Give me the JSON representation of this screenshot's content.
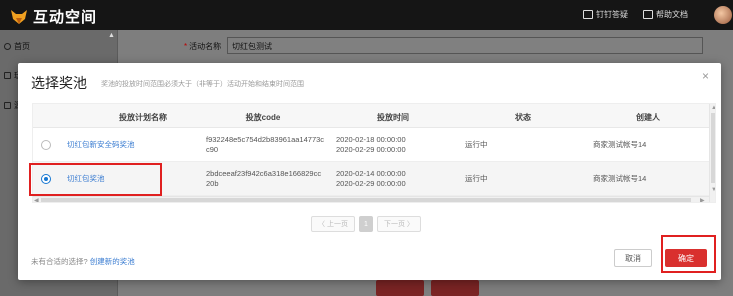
{
  "app": {
    "logo_text": "互动空间"
  },
  "topbar": {
    "pin_answer_label": "钉钉答疑",
    "help_docs_label": "帮助文档"
  },
  "sidebar": {
    "items": [
      {
        "label": "首页"
      },
      {
        "label": "玩"
      },
      {
        "label": "源"
      }
    ]
  },
  "background_form": {
    "field_label": "活动名称",
    "field_value": "切红包测试"
  },
  "modal": {
    "title": "选择奖池",
    "hint": "奖池的投放时间范围必须大于（非等于）活动开始和结束时间范围",
    "close": "×",
    "columns": [
      "投放计划名称",
      "投放code",
      "投放时间",
      "状态",
      "创建人"
    ],
    "rows": [
      {
        "selected": false,
        "name": "切红包新安全码奖池",
        "code_line1": "f932248e5c754d2b83961aa14773c",
        "code_line2": "c90",
        "time_line1": "2020-02-18 00:00:00",
        "time_line2": "2020-02-29 00:00:00",
        "status": "运行中",
        "creator": "商家测试帐号14"
      },
      {
        "selected": true,
        "name": "切红包奖池",
        "code_line1": "2bdceeaf23f942c6a318e166829cc",
        "code_line2": "20b",
        "time_line1": "2020-02-14 00:00:00",
        "time_line2": "2020-02-29 00:00:00",
        "status": "运行中",
        "creator": "商家测试帐号14"
      }
    ],
    "pagination": {
      "prev": "〈 上一页",
      "current": "1",
      "next": "下一页 〉"
    },
    "footer_text": "未有合适的选择?",
    "footer_link": "创建新的奖池",
    "cancel_label": "取消",
    "confirm_label": "确定"
  },
  "colors": {
    "accent": "#d9302e",
    "link": "#3a7cd1",
    "radio": "#1677d2",
    "highlight": "#e02020"
  }
}
